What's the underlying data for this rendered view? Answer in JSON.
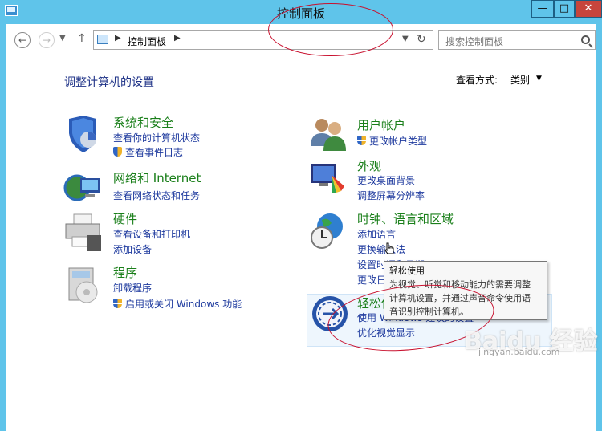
{
  "window": {
    "title": "控制面板"
  },
  "address": {
    "crumb": "控制面板"
  },
  "search": {
    "placeholder": "搜索控制面板"
  },
  "heading": "调整计算机的设置",
  "view": {
    "label": "查看方式:",
    "value": "类别"
  },
  "categories": [
    {
      "title": "系统和安全",
      "icon": "shield-security-icon",
      "links": [
        "查看你的计算机状态",
        "查看事件日志"
      ]
    },
    {
      "title": "网络和 Internet",
      "icon": "network-globe-icon",
      "links": [
        "查看网络状态和任务"
      ]
    },
    {
      "title": "硬件",
      "icon": "printer-hardware-icon",
      "links": [
        "查看设备和打印机",
        "添加设备"
      ]
    },
    {
      "title": "程序",
      "icon": "programs-disc-icon",
      "links": [
        "卸载程序",
        "启用或关闭 Windows 功能"
      ]
    },
    {
      "title": "用户帐户",
      "icon": "users-icon",
      "links": [
        "更改帐户类型"
      ]
    },
    {
      "title": "外观",
      "icon": "appearance-display-icon",
      "links": [
        "更改桌面背景",
        "调整屏幕分辨率"
      ]
    },
    {
      "title": "时钟、语言和区域",
      "icon": "clock-globe-icon",
      "links": [
        "添加语言",
        "更换输入法",
        "设置时间和日期",
        "更改日期、时间或数字格式"
      ]
    },
    {
      "title": "轻松使用",
      "icon": "ease-of-access-icon",
      "links": [
        "使用 Windows 建议的设置",
        "优化视觉显示"
      ]
    }
  ],
  "tooltip": {
    "title": "轻松使用",
    "lines": [
      "为视觉、听觉和移动能力的需要调整",
      "计算机设置，并通过声音命令使用语",
      "音识别控制计算机。"
    ]
  },
  "watermark": {
    "text": "Baidu 经验",
    "sub": "jingyan.baidu.com"
  },
  "colors": {
    "titlebar": "#5fc4ea",
    "category_title": "#1a7f1a",
    "link": "#1e3a9e",
    "heading": "#1e3287",
    "annotation": "#c8102e"
  }
}
